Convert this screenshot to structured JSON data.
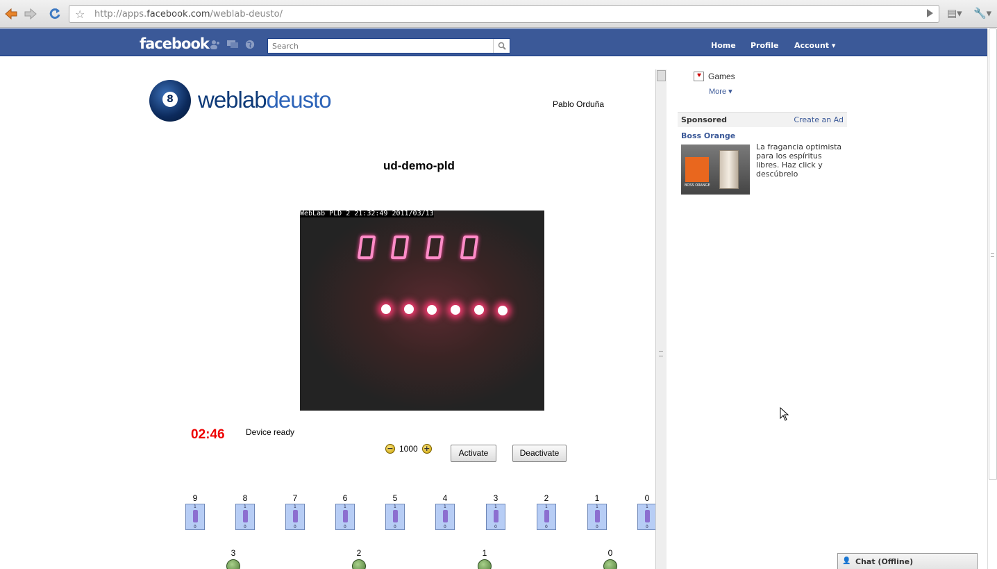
{
  "browser": {
    "url_prefix": "http://apps.",
    "url_host": "facebook.com",
    "url_path": "/weblab-deusto/"
  },
  "facebook": {
    "logo": "facebook",
    "search_placeholder": "Search",
    "nav": [
      "Home",
      "Profile",
      "Account"
    ]
  },
  "app": {
    "logo_dark": "weblab",
    "logo_light": "deusto",
    "logo_ball_number": "8",
    "user_name": "Pablo Orduña",
    "experiment_title": "ud-demo-pld",
    "webcam_caption": "WebLab PLD 2 21:32:49 2011/03/13",
    "display_digits": [
      "0",
      "0",
      "0",
      "0"
    ],
    "timer": "02:46",
    "status": "Device ready",
    "clock_value": "1000",
    "activate_label": "Activate",
    "deactivate_label": "Deactivate",
    "switch_labels": [
      "9",
      "8",
      "7",
      "6",
      "5",
      "4",
      "3",
      "2",
      "1",
      "0"
    ],
    "led_labels": [
      "3",
      "2",
      "1",
      "0"
    ],
    "switch_on": "1",
    "switch_off": "0"
  },
  "sidebar": {
    "games_label": "Games",
    "more_label": "More",
    "sponsored_label": "Sponsored",
    "create_ad_label": "Create an Ad",
    "ad_title": "Boss Orange",
    "ad_text": "La fragancia optimista para los espíritus libres. Haz click y descúbrelo",
    "ad_brand": "BOSS ORANGE"
  },
  "chat": {
    "label": "Chat (Offline)"
  },
  "colors": {
    "fb_blue": "#3b5998",
    "timer_red": "#e00000",
    "segment_pink": "#ff8cc8"
  }
}
